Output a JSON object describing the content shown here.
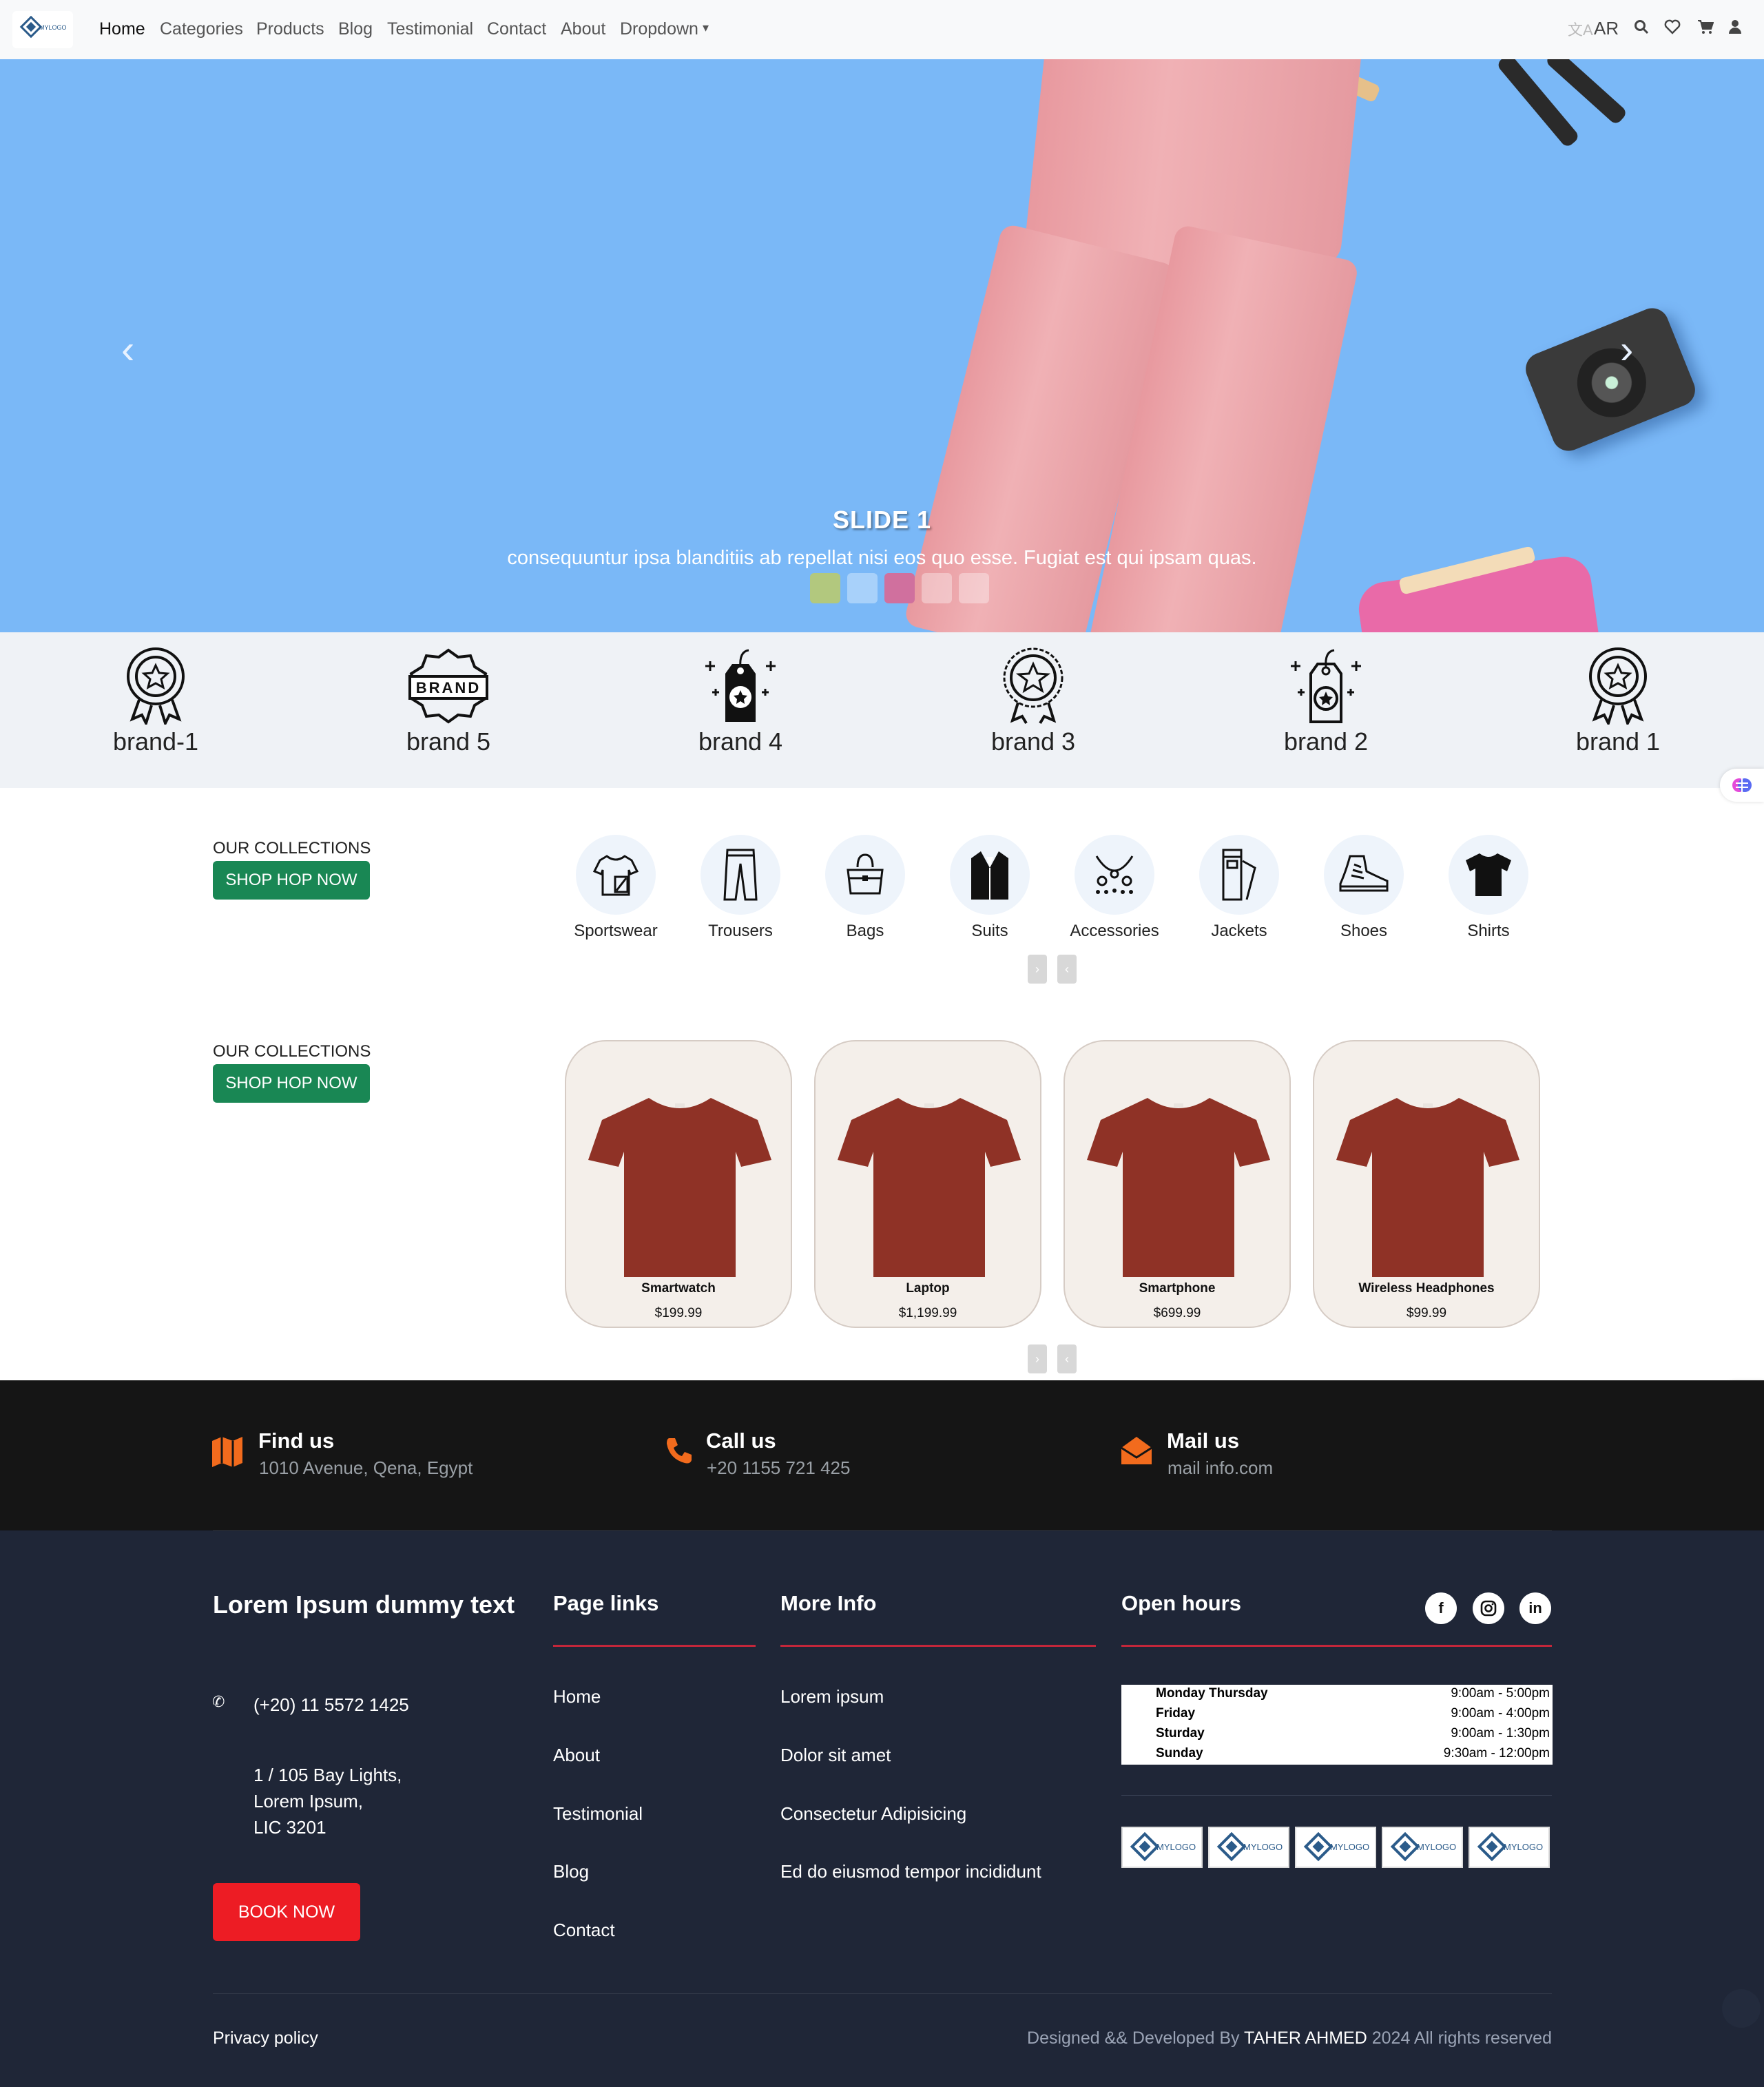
{
  "nav": {
    "logo_text": "MYLOGO",
    "links": [
      "Home",
      "Categories",
      "Products",
      "Blog",
      "Testimonial",
      "Contact",
      "About",
      "Dropdown"
    ],
    "lang": "AR"
  },
  "hero": {
    "title": "SLIDE 1",
    "text": "consequuntur ipsa blanditiis ab repellat nisi eos quo esse. Fugiat est qui ipsam quas."
  },
  "brands": [
    "brand-1",
    "brand 5",
    "brand 4",
    "brand 3",
    "brand 2",
    "brand 1"
  ],
  "collections1": {
    "heading": "OUR COLLECTIONS",
    "button": "SHOP HOP NOW",
    "categories": [
      "Sportswear",
      "Trousers",
      "Bags",
      "Suits",
      "Accessories",
      "Jackets",
      "Shoes",
      "Shirts"
    ]
  },
  "collections2": {
    "heading": "OUR COLLECTIONS",
    "button": "SHOP HOP NOW",
    "products": [
      {
        "name": "Smartwatch",
        "price": "$199.99"
      },
      {
        "name": "Laptop",
        "price": "$1,199.99"
      },
      {
        "name": "Smartphone",
        "price": "$699.99"
      },
      {
        "name": "Wireless Headphones",
        "price": "$99.99"
      }
    ]
  },
  "contact": {
    "find": {
      "title": "Find us",
      "text": "1010 Avenue, Qena, Egypt"
    },
    "call": {
      "title": "Call us",
      "text": "+20 1155 721 425"
    },
    "mail": {
      "title": "Mail us",
      "text": "mail info.com"
    }
  },
  "footer": {
    "about_title": "Lorem Ipsum dummy text",
    "phone": "(+20) 11 5572 1425",
    "address": [
      "1 / 105 Bay Lights,",
      "Lorem Ipsum,",
      "LIC 3201"
    ],
    "book_button": "BOOK NOW",
    "page_links_title": "Page links",
    "page_links": [
      "Home",
      "About",
      "Testimonial",
      "Blog",
      "Contact"
    ],
    "more_info_title": "More Info",
    "more_info": [
      "Lorem ipsum",
      "Dolor sit amet",
      "Consectetur Adipisicing",
      "Ed do eiusmod tempor incididunt"
    ],
    "hours_title": "Open hours",
    "hours": [
      {
        "day": "Monday Thursday",
        "time": "9:00am - 5:00pm"
      },
      {
        "day": "Friday",
        "time": "9:00am - 4:00pm"
      },
      {
        "day": "Sturday",
        "time": "9:00am - 1:30pm"
      },
      {
        "day": "Sunday",
        "time": "9:30am - 12:00pm"
      }
    ],
    "social": [
      "f",
      "ig",
      "in"
    ],
    "privacy": "Privacy policy",
    "credit_prefix": "Designed && Developed By",
    "credit_author": "TAHER AHMED",
    "credit_suffix": "2024 All rights reserved"
  },
  "colors": {
    "accent_green": "#198754",
    "book_red": "#ed1c24",
    "icon_orange": "#f26b1d",
    "footer_bg": "#1f2637",
    "hero_bg": "#7ab8f7"
  }
}
